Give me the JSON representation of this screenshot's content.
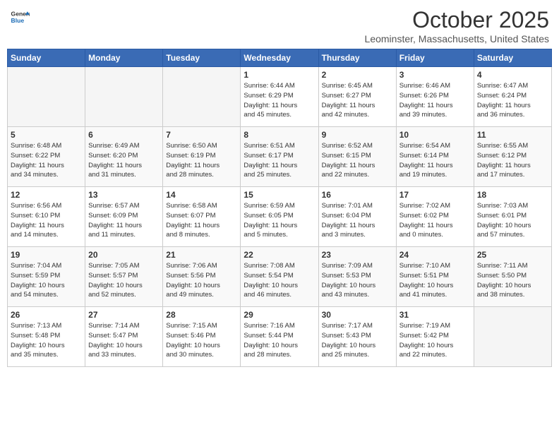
{
  "header": {
    "logo_line1": "General",
    "logo_line2": "Blue",
    "month": "October 2025",
    "location": "Leominster, Massachusetts, United States"
  },
  "weekdays": [
    "Sunday",
    "Monday",
    "Tuesday",
    "Wednesday",
    "Thursday",
    "Friday",
    "Saturday"
  ],
  "weeks": [
    [
      {
        "day": "",
        "info": ""
      },
      {
        "day": "",
        "info": ""
      },
      {
        "day": "",
        "info": ""
      },
      {
        "day": "1",
        "info": "Sunrise: 6:44 AM\nSunset: 6:29 PM\nDaylight: 11 hours\nand 45 minutes."
      },
      {
        "day": "2",
        "info": "Sunrise: 6:45 AM\nSunset: 6:27 PM\nDaylight: 11 hours\nand 42 minutes."
      },
      {
        "day": "3",
        "info": "Sunrise: 6:46 AM\nSunset: 6:26 PM\nDaylight: 11 hours\nand 39 minutes."
      },
      {
        "day": "4",
        "info": "Sunrise: 6:47 AM\nSunset: 6:24 PM\nDaylight: 11 hours\nand 36 minutes."
      }
    ],
    [
      {
        "day": "5",
        "info": "Sunrise: 6:48 AM\nSunset: 6:22 PM\nDaylight: 11 hours\nand 34 minutes."
      },
      {
        "day": "6",
        "info": "Sunrise: 6:49 AM\nSunset: 6:20 PM\nDaylight: 11 hours\nand 31 minutes."
      },
      {
        "day": "7",
        "info": "Sunrise: 6:50 AM\nSunset: 6:19 PM\nDaylight: 11 hours\nand 28 minutes."
      },
      {
        "day": "8",
        "info": "Sunrise: 6:51 AM\nSunset: 6:17 PM\nDaylight: 11 hours\nand 25 minutes."
      },
      {
        "day": "9",
        "info": "Sunrise: 6:52 AM\nSunset: 6:15 PM\nDaylight: 11 hours\nand 22 minutes."
      },
      {
        "day": "10",
        "info": "Sunrise: 6:54 AM\nSunset: 6:14 PM\nDaylight: 11 hours\nand 19 minutes."
      },
      {
        "day": "11",
        "info": "Sunrise: 6:55 AM\nSunset: 6:12 PM\nDaylight: 11 hours\nand 17 minutes."
      }
    ],
    [
      {
        "day": "12",
        "info": "Sunrise: 6:56 AM\nSunset: 6:10 PM\nDaylight: 11 hours\nand 14 minutes."
      },
      {
        "day": "13",
        "info": "Sunrise: 6:57 AM\nSunset: 6:09 PM\nDaylight: 11 hours\nand 11 minutes."
      },
      {
        "day": "14",
        "info": "Sunrise: 6:58 AM\nSunset: 6:07 PM\nDaylight: 11 hours\nand 8 minutes."
      },
      {
        "day": "15",
        "info": "Sunrise: 6:59 AM\nSunset: 6:05 PM\nDaylight: 11 hours\nand 5 minutes."
      },
      {
        "day": "16",
        "info": "Sunrise: 7:01 AM\nSunset: 6:04 PM\nDaylight: 11 hours\nand 3 minutes."
      },
      {
        "day": "17",
        "info": "Sunrise: 7:02 AM\nSunset: 6:02 PM\nDaylight: 11 hours\nand 0 minutes."
      },
      {
        "day": "18",
        "info": "Sunrise: 7:03 AM\nSunset: 6:01 PM\nDaylight: 10 hours\nand 57 minutes."
      }
    ],
    [
      {
        "day": "19",
        "info": "Sunrise: 7:04 AM\nSunset: 5:59 PM\nDaylight: 10 hours\nand 54 minutes."
      },
      {
        "day": "20",
        "info": "Sunrise: 7:05 AM\nSunset: 5:57 PM\nDaylight: 10 hours\nand 52 minutes."
      },
      {
        "day": "21",
        "info": "Sunrise: 7:06 AM\nSunset: 5:56 PM\nDaylight: 10 hours\nand 49 minutes."
      },
      {
        "day": "22",
        "info": "Sunrise: 7:08 AM\nSunset: 5:54 PM\nDaylight: 10 hours\nand 46 minutes."
      },
      {
        "day": "23",
        "info": "Sunrise: 7:09 AM\nSunset: 5:53 PM\nDaylight: 10 hours\nand 43 minutes."
      },
      {
        "day": "24",
        "info": "Sunrise: 7:10 AM\nSunset: 5:51 PM\nDaylight: 10 hours\nand 41 minutes."
      },
      {
        "day": "25",
        "info": "Sunrise: 7:11 AM\nSunset: 5:50 PM\nDaylight: 10 hours\nand 38 minutes."
      }
    ],
    [
      {
        "day": "26",
        "info": "Sunrise: 7:13 AM\nSunset: 5:48 PM\nDaylight: 10 hours\nand 35 minutes."
      },
      {
        "day": "27",
        "info": "Sunrise: 7:14 AM\nSunset: 5:47 PM\nDaylight: 10 hours\nand 33 minutes."
      },
      {
        "day": "28",
        "info": "Sunrise: 7:15 AM\nSunset: 5:46 PM\nDaylight: 10 hours\nand 30 minutes."
      },
      {
        "day": "29",
        "info": "Sunrise: 7:16 AM\nSunset: 5:44 PM\nDaylight: 10 hours\nand 28 minutes."
      },
      {
        "day": "30",
        "info": "Sunrise: 7:17 AM\nSunset: 5:43 PM\nDaylight: 10 hours\nand 25 minutes."
      },
      {
        "day": "31",
        "info": "Sunrise: 7:19 AM\nSunset: 5:42 PM\nDaylight: 10 hours\nand 22 minutes."
      },
      {
        "day": "",
        "info": ""
      }
    ]
  ]
}
